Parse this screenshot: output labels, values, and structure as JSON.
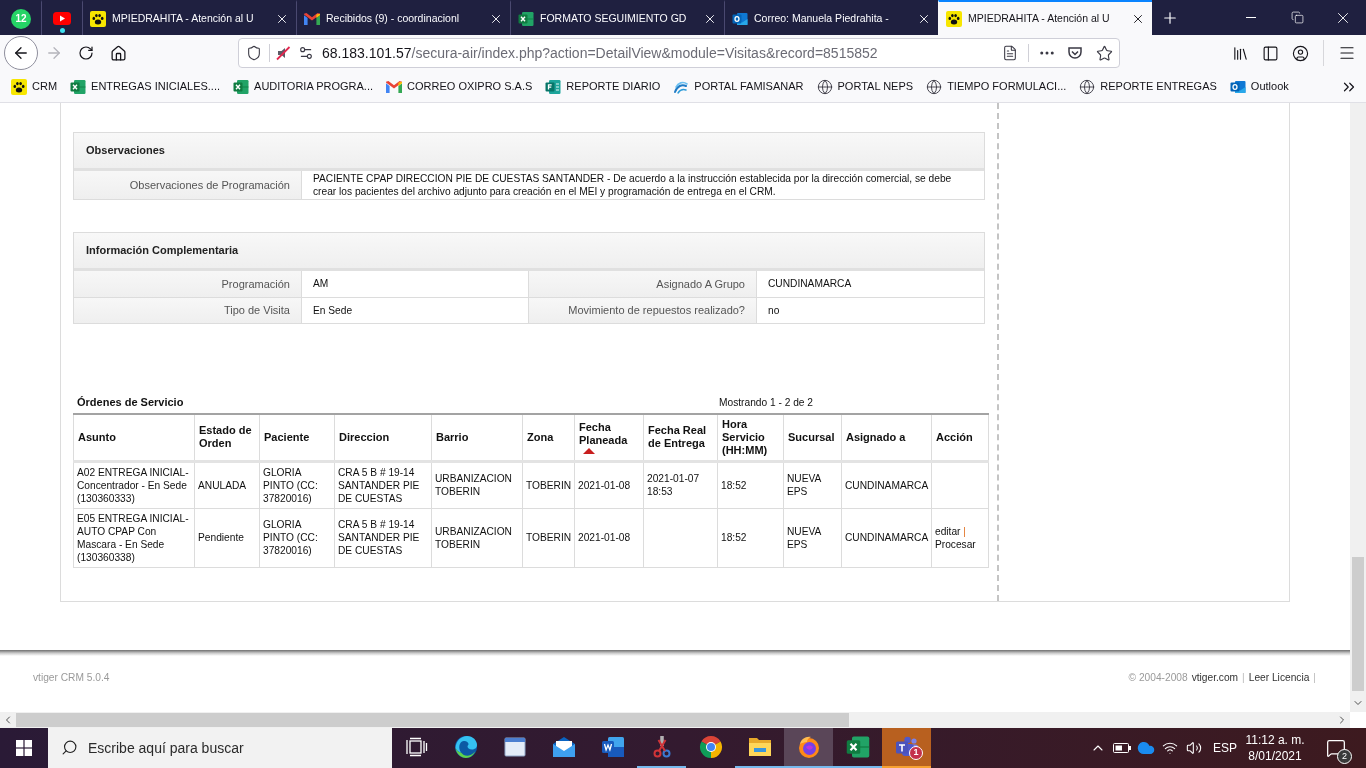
{
  "browser": {
    "tabs": [
      {
        "kind": "chat",
        "pinned": true,
        "badge": "12",
        "attention": false,
        "selected": false
      },
      {
        "kind": "video",
        "pinned": true,
        "attention": true,
        "selected": false
      },
      {
        "kind": "paw",
        "pinned": false,
        "title": "MPIEDRAHITA - Atención al U",
        "attention": false,
        "selected": false
      },
      {
        "kind": "gmail",
        "pinned": false,
        "title": "Recibidos (9) - coordinacionl",
        "attention": false,
        "selected": false
      },
      {
        "kind": "excel",
        "pinned": false,
        "title": "FORMATO SEGUIMIENTO GD",
        "attention": false,
        "selected": false
      },
      {
        "kind": "outlook",
        "pinned": false,
        "title": "Correo: Manuela Piedrahita -",
        "attention": false,
        "selected": false
      },
      {
        "kind": "paw",
        "pinned": false,
        "title": "MPIEDRAHITA - Atención al U",
        "attention": false,
        "selected": true
      }
    ],
    "navigation": {
      "back": {
        "disabled": false
      },
      "forward": {
        "disabled": true
      }
    },
    "address": {
      "host": "68.183.101.57",
      "path": "/secura-air/index.php?action=DetailView&module=Visitas&record=8515852"
    },
    "bookmarks": [
      {
        "kind": "paw",
        "label": "CRM"
      },
      {
        "kind": "excel",
        "label": "ENTREGAS INICIALES...."
      },
      {
        "kind": "excel",
        "label": "AUDITORIA PROGRA..."
      },
      {
        "kind": "gmail",
        "label": "CORREO OXIPRO S.A.S"
      },
      {
        "kind": "forms",
        "label": "REPORTE DIARIO"
      },
      {
        "kind": "swirl",
        "label": "PORTAL FAMISANAR"
      },
      {
        "kind": "globe",
        "label": "PORTAL NEPS"
      },
      {
        "kind": "globe",
        "label": "TIEMPO FORMULACI..."
      },
      {
        "kind": "globe",
        "label": "REPORTE ENTREGAS"
      },
      {
        "kind": "outlook",
        "label": "Outlook"
      }
    ]
  },
  "observaciones": {
    "title": "Observaciones",
    "fields": [
      {
        "label": "Observaciones de Programación",
        "value": "PACIENTE CPAP DIRECCION PIE DE CUESTAS SANTANDER - De acuerdo a la instrucción establecida por la dirección comercial, se debe crear los pacientes del archivo adjunto para creación en el MEI y programación de entrega en el CRM."
      }
    ]
  },
  "informacion_complementaria": {
    "title": "Información Complementaria",
    "rows": [
      {
        "fields": [
          {
            "label": "Programación",
            "value": "AM"
          },
          {
            "label": "Asignado A Grupo",
            "value": "CUNDINAMARCA"
          }
        ]
      },
      {
        "fields": [
          {
            "label": "Tipo de Visita",
            "value": "En Sede"
          },
          {
            "label": "Movimiento de repuestos realizado?",
            "value": "no"
          }
        ]
      }
    ]
  },
  "ordenes_de_servicio": {
    "title": "Órdenes de Servicio",
    "paging": "Mostrando 1 - 2 de 2",
    "columns": [
      {
        "label": "Asunto",
        "sorted": false
      },
      {
        "label": "Estado de Orden",
        "sorted": false
      },
      {
        "label": "Paciente",
        "sorted": false
      },
      {
        "label": "Direccion",
        "sorted": false
      },
      {
        "label": "Barrio",
        "sorted": false
      },
      {
        "label": "Zona",
        "sorted": false
      },
      {
        "label": "Fecha Planeada",
        "sorted": true
      },
      {
        "label": "Fecha Real de Entrega",
        "sorted": false
      },
      {
        "label": "Hora Servicio (HH:MM)",
        "sorted": false
      },
      {
        "label": "Sucursal",
        "sorted": false
      },
      {
        "label": "Asignado a",
        "sorted": false
      },
      {
        "label": "Acción",
        "sorted": false
      }
    ],
    "rows": [
      {
        "asunto": "A02 ENTREGA INICIAL-Concentrador - En Sede (130360333)",
        "estado": "ANULADA",
        "paciente": "GLORIA PINTO (CC: 37820016)",
        "direccion": "CRA 5 B # 19-14 SANTANDER PIE DE CUESTAS",
        "barrio": "URBANIZACION TOBERIN",
        "zona": "TOBERIN",
        "fecha_planeada": "2021-01-08",
        "fecha_real": "2021-01-07 18:53",
        "hora": "18:52",
        "sucursal": "NUEVA EPS",
        "asignado": "CUNDINAMARCA"
      },
      {
        "asunto": "E05 ENTREGA INICIAL-AUTO CPAP Con Mascara - En Sede (130360338)",
        "estado": "Pendiente",
        "paciente": "GLORIA PINTO (CC: 37820016)",
        "direccion": "CRA 5 B # 19-14 SANTANDER PIE DE CUESTAS",
        "barrio": "URBANIZACION TOBERIN",
        "zona": "TOBERIN",
        "fecha_planeada": "2021-01-08",
        "hora": "18:52",
        "sucursal": "NUEVA EPS",
        "asignado": "CUNDINAMARCA",
        "accion": [
          {
            "kind": "link",
            "text": "editar"
          },
          {
            "kind": "separator",
            "text": "|"
          },
          {
            "kind": "link",
            "text": "Procesar"
          }
        ]
      }
    ]
  },
  "footer": {
    "version": "vtiger CRM 5.0.4",
    "items": [
      {
        "kind": "text",
        "text": "© 2004-2008"
      },
      {
        "kind": "link",
        "text": "vtiger.com"
      },
      {
        "kind": "separator",
        "text": "|"
      },
      {
        "kind": "link",
        "text": "Leer Licencia"
      },
      {
        "kind": "separator",
        "text": "|"
      }
    ]
  },
  "taskbar": {
    "search": {
      "placeholder": "Escribe aquí para buscar"
    },
    "apps": [
      {
        "kind": "taskview",
        "running": false,
        "selected": false,
        "attention": false
      },
      {
        "kind": "edge",
        "running": false,
        "selected": false,
        "attention": false
      },
      {
        "kind": "window",
        "running": false,
        "selected": false,
        "attention": false
      },
      {
        "kind": "mail",
        "running": false,
        "selected": false,
        "attention": false
      },
      {
        "kind": "word",
        "running": false,
        "selected": false,
        "attention": false
      },
      {
        "kind": "snip",
        "running": true,
        "selected": false,
        "attention": false
      },
      {
        "kind": "chrome",
        "running": false,
        "selected": false,
        "attention": false
      },
      {
        "kind": "explorer",
        "running": true,
        "selected": false,
        "attention": false
      },
      {
        "kind": "firefox",
        "running": true,
        "selected": true,
        "attention": false
      },
      {
        "kind": "excel",
        "running": true,
        "selected": false,
        "attention": false
      },
      {
        "kind": "teams",
        "running": true,
        "selected": false,
        "attention": true,
        "badge": "1"
      }
    ],
    "tray": {
      "language": "ESP",
      "time": "11:12 a. m.",
      "date": "8/01/2021",
      "notifications": "2"
    }
  }
}
